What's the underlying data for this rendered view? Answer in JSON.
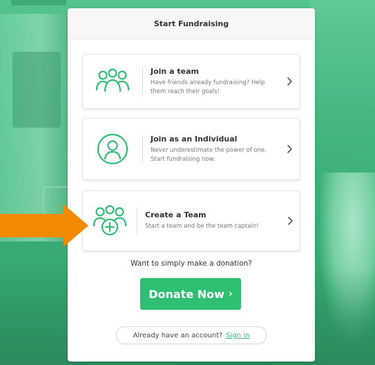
{
  "card": {
    "header_title": "Start Fundraising"
  },
  "options": [
    {
      "title": "Join a team",
      "description": "Have friends already fundraising? Help them reach their goals!",
      "icon": "group-icon"
    },
    {
      "title": "Join as an Individual",
      "description": "Never underestimate the power of one. Start fundraising now.",
      "icon": "person-circle-icon"
    },
    {
      "title": "Create a Team",
      "description": "Start a team and be the team captain!",
      "icon": "group-add-icon"
    }
  ],
  "donate": {
    "prompt": "Want to simply make a donation?",
    "button_label": "Donate Now",
    "button_arrow": "›"
  },
  "account": {
    "prompt": "Already have an account?",
    "sign_in_label": "Sign in"
  },
  "colors": {
    "accent_green": "#2fbf72",
    "icon_green": "#2dbd74",
    "pointer_orange": "#f28a00"
  }
}
